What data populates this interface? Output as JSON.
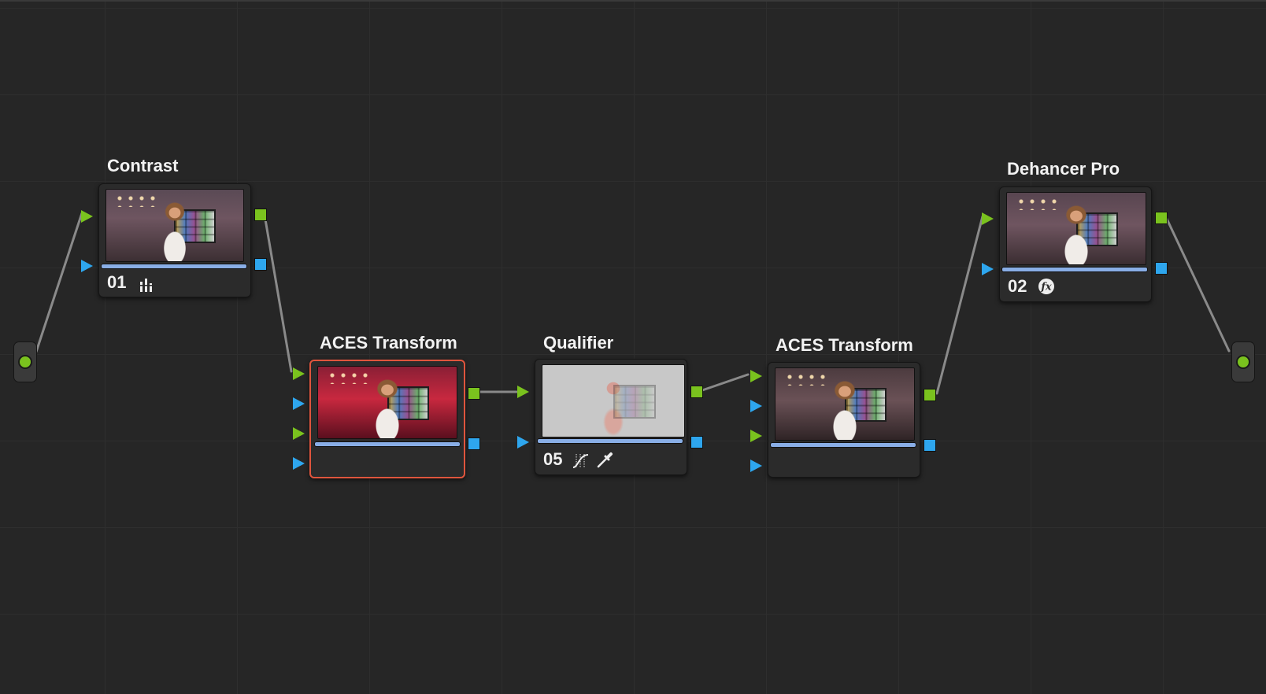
{
  "nodes": [
    {
      "key": "contrast",
      "label": "Contrast",
      "number": "01",
      "icon": "bars-chart-icon"
    },
    {
      "key": "aces1",
      "label": "ACES Transform",
      "number": "",
      "icon": ""
    },
    {
      "key": "qualifier",
      "label": "Qualifier",
      "number": "05",
      "icon": "curve-qualifier-icon eyedropper-icon"
    },
    {
      "key": "aces2",
      "label": "ACES Transform",
      "number": "",
      "icon": ""
    },
    {
      "key": "dehancer",
      "label": "Dehancer Pro",
      "number": "02",
      "icon": "fx-icon"
    }
  ],
  "colors": {
    "background": "#262626",
    "rgb_input": "#7ac21e",
    "alpha_input": "#2ea6ee",
    "selected_border": "#e0553d",
    "link_line": "#8a8a8a"
  },
  "selected_node": "aces1"
}
